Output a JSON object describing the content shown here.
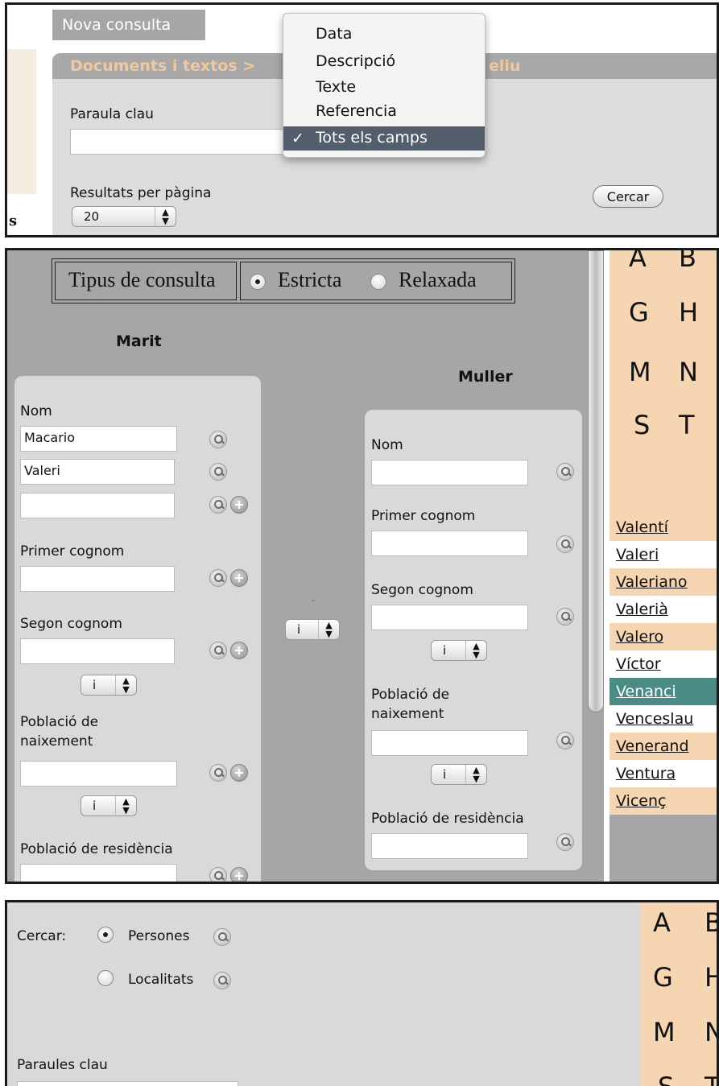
{
  "panel1": {
    "title": "Nova consulta",
    "breadcrumb_visible": "Documents i textos >",
    "breadcrumb_tail": "eliu",
    "keyword_label": "Paraula clau",
    "keyword_value": "",
    "results_label": "Resultats per pàgina",
    "results_value": "20",
    "search_button": "Cercar",
    "left_edge_char": "s",
    "dropdown": {
      "items": [
        "Data",
        "Descripció",
        "Texte",
        "Referencia",
        "Tots els camps"
      ],
      "selected": "Tots els camps",
      "check": "✓"
    }
  },
  "panel2": {
    "query_type_label": "Tipus de consulta",
    "option_strict": "Estricta",
    "option_relaxed": "Relaxada",
    "selected_option": "Estricta",
    "husband": {
      "heading": "Marit",
      "name_label": "Nom",
      "name_values": [
        "Macario",
        "Valeri",
        ""
      ],
      "first_surname_label": "Primer cognom",
      "second_surname_label": "Segon cognom",
      "birth_town_label_1": "Població de",
      "birth_town_label_2": "naixement",
      "residence_label": "Població de residència",
      "connector": "i"
    },
    "middle_connector": "i",
    "wife": {
      "heading": "Muller",
      "name_label": "Nom",
      "first_surname_label": "Primer cognom",
      "second_surname_label": "Segon cognom",
      "birth_town_label_1": "Població de",
      "birth_town_label_2": "naixement",
      "residence_label": "Població de residència",
      "connector": "i"
    },
    "alphabet": [
      "A",
      "B",
      "G",
      "H",
      "M",
      "N",
      "S",
      "T"
    ],
    "names": [
      "Valentí",
      "Valeri",
      "Valeriano",
      "Valerià",
      "Valero",
      "Víctor",
      "Venanci",
      "Venceslau",
      "Venerand",
      "Ventura",
      "Vicenç"
    ],
    "highlighted_name": "Venanci",
    "colors": {
      "peach": "#f5d5b2",
      "highlight": "#4a8b86",
      "panel_gray": "#a6a6a6",
      "form_gray": "#d9d9d9"
    }
  },
  "panel3": {
    "search_label": "Cercar:",
    "option_persons": "Persones",
    "option_places": "Localitats",
    "keywords_label": "Paraules clau",
    "alphabet": [
      "A",
      "B",
      "G",
      "H",
      "M",
      "N",
      "S",
      "T"
    ]
  }
}
